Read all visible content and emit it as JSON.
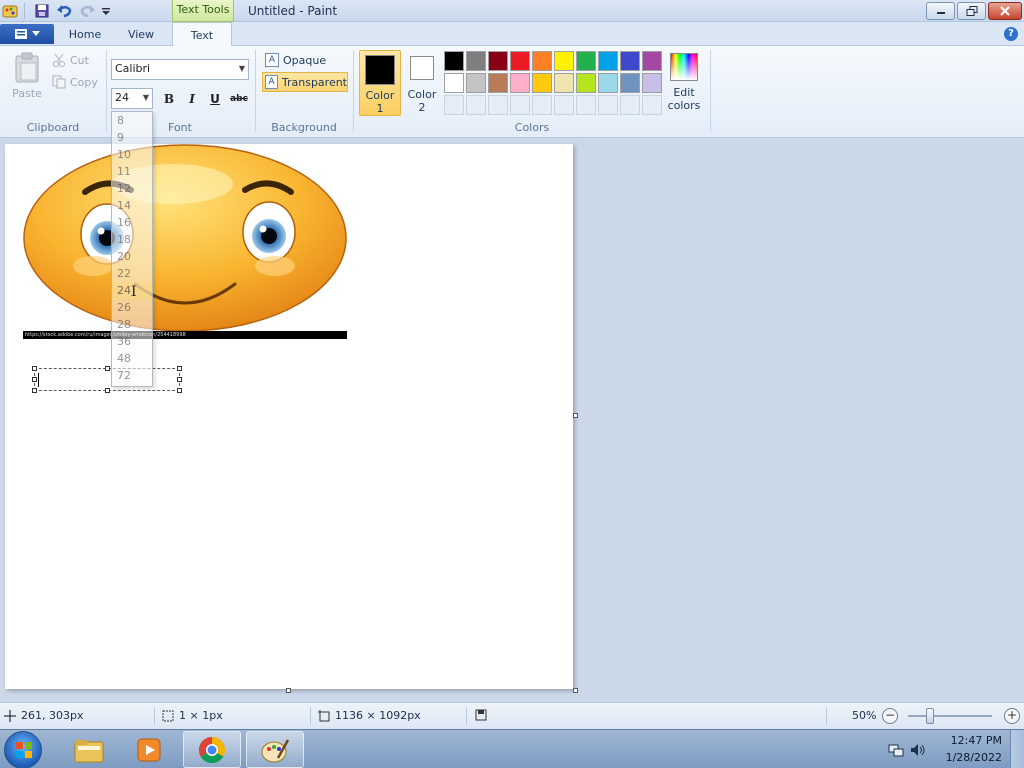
{
  "window": {
    "title": "Untitled - Paint",
    "context_tab": "Text Tools"
  },
  "tabs": [
    {
      "label": "Home"
    },
    {
      "label": "View"
    },
    {
      "label": "Text"
    }
  ],
  "clipboard": {
    "paste": "Paste",
    "cut": "Cut",
    "copy": "Copy",
    "group": "Clipboard"
  },
  "font": {
    "family": "Calibri",
    "size": "24",
    "group": "Font",
    "bold": "B",
    "italic": "I",
    "underline": "U",
    "strike": "abc"
  },
  "background": {
    "opaque": "Opaque",
    "transparent": "Transparent",
    "group": "Background"
  },
  "colors": {
    "group": "Colors",
    "color1_label": "Color 1",
    "color1_line1": "Color",
    "color1_line2": "1",
    "color2_line1": "Color",
    "color2_line2": "2",
    "edit_line1": "Edit",
    "edit_line2": "colors",
    "color1_value": "#000000",
    "color2_value": "#ffffff",
    "palette_row1": [
      "#000000",
      "#7f7f7f",
      "#880015",
      "#ed1c24",
      "#ff7f27",
      "#fff200",
      "#22b14c",
      "#00a2e8",
      "#3f48cc",
      "#a349a4"
    ],
    "palette_row2": [
      "#ffffff",
      "#c3c3c3",
      "#b97a57",
      "#ffaec9",
      "#ffc90e",
      "#efe4b0",
      "#b5e61d",
      "#99d9ea",
      "#7092be",
      "#c8bfe7"
    ]
  },
  "size_dropdown": {
    "options": [
      "8",
      "9",
      "10",
      "11",
      "12",
      "14",
      "16",
      "18",
      "20",
      "22",
      "24",
      "26",
      "28",
      "36",
      "48",
      "72"
    ],
    "selected": "24"
  },
  "canvas": {
    "url_text": "https://stock.adobe.com/ru/images/smiley-emoticon/254418998"
  },
  "status": {
    "cursor_pos": "261, 303px",
    "selection_size": "1 × 1px",
    "image_size": "1136 × 1092px",
    "zoom": "50%",
    "zoom_minus": "−",
    "zoom_plus": "+",
    "zoom_fraction": 0.26
  },
  "taskbar": {
    "time": "12:47 PM",
    "date": "1/28/2022"
  }
}
